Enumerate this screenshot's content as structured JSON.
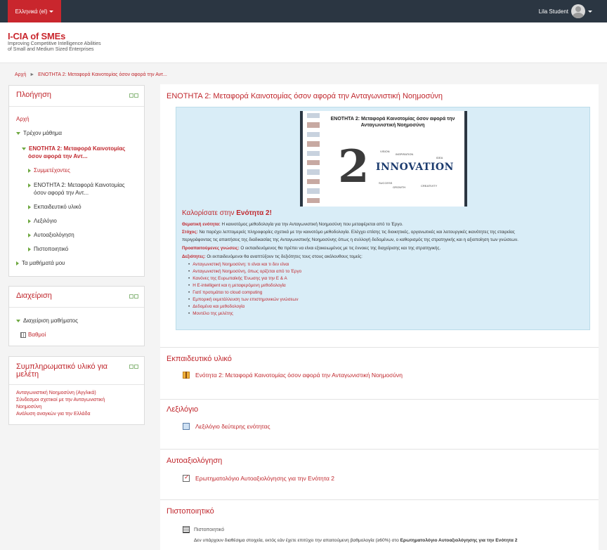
{
  "topbar": {
    "language": "Ελληνικά (el)",
    "user_name": "Lila Student"
  },
  "logo": {
    "title": "I-CIA of SMEs",
    "line1": "Improving Competitive Intelligence Abilities",
    "line2": "of Small and Medium Sized Enterprises"
  },
  "breadcrumb": {
    "home": "Αρχή",
    "separator": "►",
    "current": "ΕΝΟΤΗΤΑ 2: Μεταφορά Καινοτομίας όσον αφορά την Αντ..."
  },
  "navigation": {
    "title": "Πλοήγηση",
    "home": "Αρχή",
    "current_course": "Τρέχον μάθημα",
    "unit_line1": "ΕΝΟΤΗΤΑ 2: Μεταφορά Καινοτομίας",
    "unit_line2": "όσον αφορά την Αντ...",
    "participants": "Συμμετέχοντες",
    "topic_line1": "ΕΝΟΤΗΤΑ 2: Μεταφορά Καινοτομίας",
    "topic_line2": "όσον αφορά την Αντ...",
    "material": "Εκπαιδευτικό υλικό",
    "glossary": "Λεξιλόγιο",
    "self_assessment": "Αυτοαξιολόγηση",
    "certificate": "Πιστοποιητικό",
    "my_courses": "Τα μαθήματά μου"
  },
  "administration": {
    "title": "Διαχείριση",
    "course_admin": "Διαχείριση μαθήματος",
    "grades": "Βαθμοί"
  },
  "supplementary": {
    "title_line1": "Συμπληρωματικό υλικό για",
    "title_line2": "μελέτη",
    "link1": "Ανταγωνιστική Νοημοσύνη (Αγγλικά)",
    "link2_line1": "Σύνδεσμοι σχετικοί με την Ανταγωνιστική",
    "link2_line2": "Νοημοσύνη",
    "link3": "Ανάλυση αναγκών για την Ελλάδα"
  },
  "main": {
    "unit_title": "ΕΝΟΤΗΤΑ 2: Μεταφορά Καινοτομίας όσον αφορά την Ανταγωνιστική Νοημοσύνη",
    "banner": {
      "title_line1": "ΕΝΟΤΗΤΑ 2: Μεταφορά Καινοτομίας όσον αφορά την",
      "title_line2": "Ανταγωνιστική Νοημοσύνη",
      "number": "2",
      "word": "INNOVATION",
      "tag_vision": "VISION",
      "tag_inspiration": "INSPIRATION",
      "tag_idea": "IDEA",
      "tag_success": "SUCCESS",
      "tag_growth": "GROWTH",
      "tag_creativity": "CREATIVITY"
    },
    "welcome_prefix": "Καλορίσατε στην ",
    "welcome_bold": "Ενότητα 2!",
    "thematic_label": "Θεματική ενότητα:",
    "thematic_text": " Η καινοτόμος μεθοδολογία για την Ανταγωνιστική Νοημοσύνη που μεταφέρεται από το Έργο.",
    "goal_label": "Στόχος:",
    "goal_text": " Να παρέχει λεπτομερείς πληροφορίες σχετικά με την καινοτόμο μεθοδολογία. Ελέγχει επίσης τις διοικητικές, οργανωτικές και λειτουργικές ικανότητες της εταιρείας",
    "goal_text2": "περιγράφοντας τις απαιτήσεις της διαδικασίας της Ανταγωνιστικής Νοημοσύνης όπως η συλλογή δεδομένων, ο καθορισμός της στρατηγικής και η αξιοποίηση των γνώσεων.",
    "prereq_label": "Προαπαιτούμενες γνώσεις:",
    "prereq_text": " Ο εκπαιδευόμενος θα πρέπει να είναι εξοικειωμένος με τις έννοιες της διαχείρισης και της στρατηγικής.",
    "skills_label": "Δεξιότητες:",
    "skills_text": " Οι εκπαιδευόμενοι θα αναπτύξουν τις δεξιότητες τους στους ακόλουθους τομείς:",
    "skills": [
      "Ανταγωνιστική Νοημοσύνη: τι είναι και τι δεν είναι",
      "Ανταγωνιστική Νοημοσύνη, όπως ορίζεται από το Έργο",
      "Κανόνες της Ευρωπαϊκής Ένωσης για την Ε & Α",
      "Η E-intelligent και η μεταφερόμενη μεθοδολογία",
      "Γιατί προτιμάται το cloud computing",
      "Εμπορική εκμετάλλευση των επιστημονικών γνώσεων",
      "Δεδομένα και μεθοδολογία",
      "Μοντέλο της μελέτης"
    ],
    "sections": {
      "material_title": "Εκπαιδευτικό υλικό",
      "material_item": "Ενότητα 2: Μεταφορά Καινοτομίας όσον αφορά την Ανταγωνιστική Νοημοσύνη",
      "glossary_title": "Λεξιλόγιο",
      "glossary_item": "Λεξιλόγιο δεύτερης ενότητας",
      "assessment_title": "Αυτοαξιολόγηση",
      "assessment_item": "Ερωτηματολόγιο Αυτοαξιολόγησης για την Ενότητα 2",
      "certificate_title": "Πιστοποιητικό",
      "certificate_item": "Πιστοποιητικό",
      "certificate_note": "Δεν υπάρχουν διαθέσιμα στοιχεία, εκτός εάν έχετε επιτύχει την απαιτούμενη βαθμολογία (≥60%) στο ",
      "certificate_note_bold": "Ερωτηματολόγιο Αυτοαξιολόγησης για την Ενότητα 2"
    }
  },
  "colors": {
    "accent": "#c9262d",
    "topbar": "#2b3642",
    "summary_bg": "#d9edf7"
  }
}
